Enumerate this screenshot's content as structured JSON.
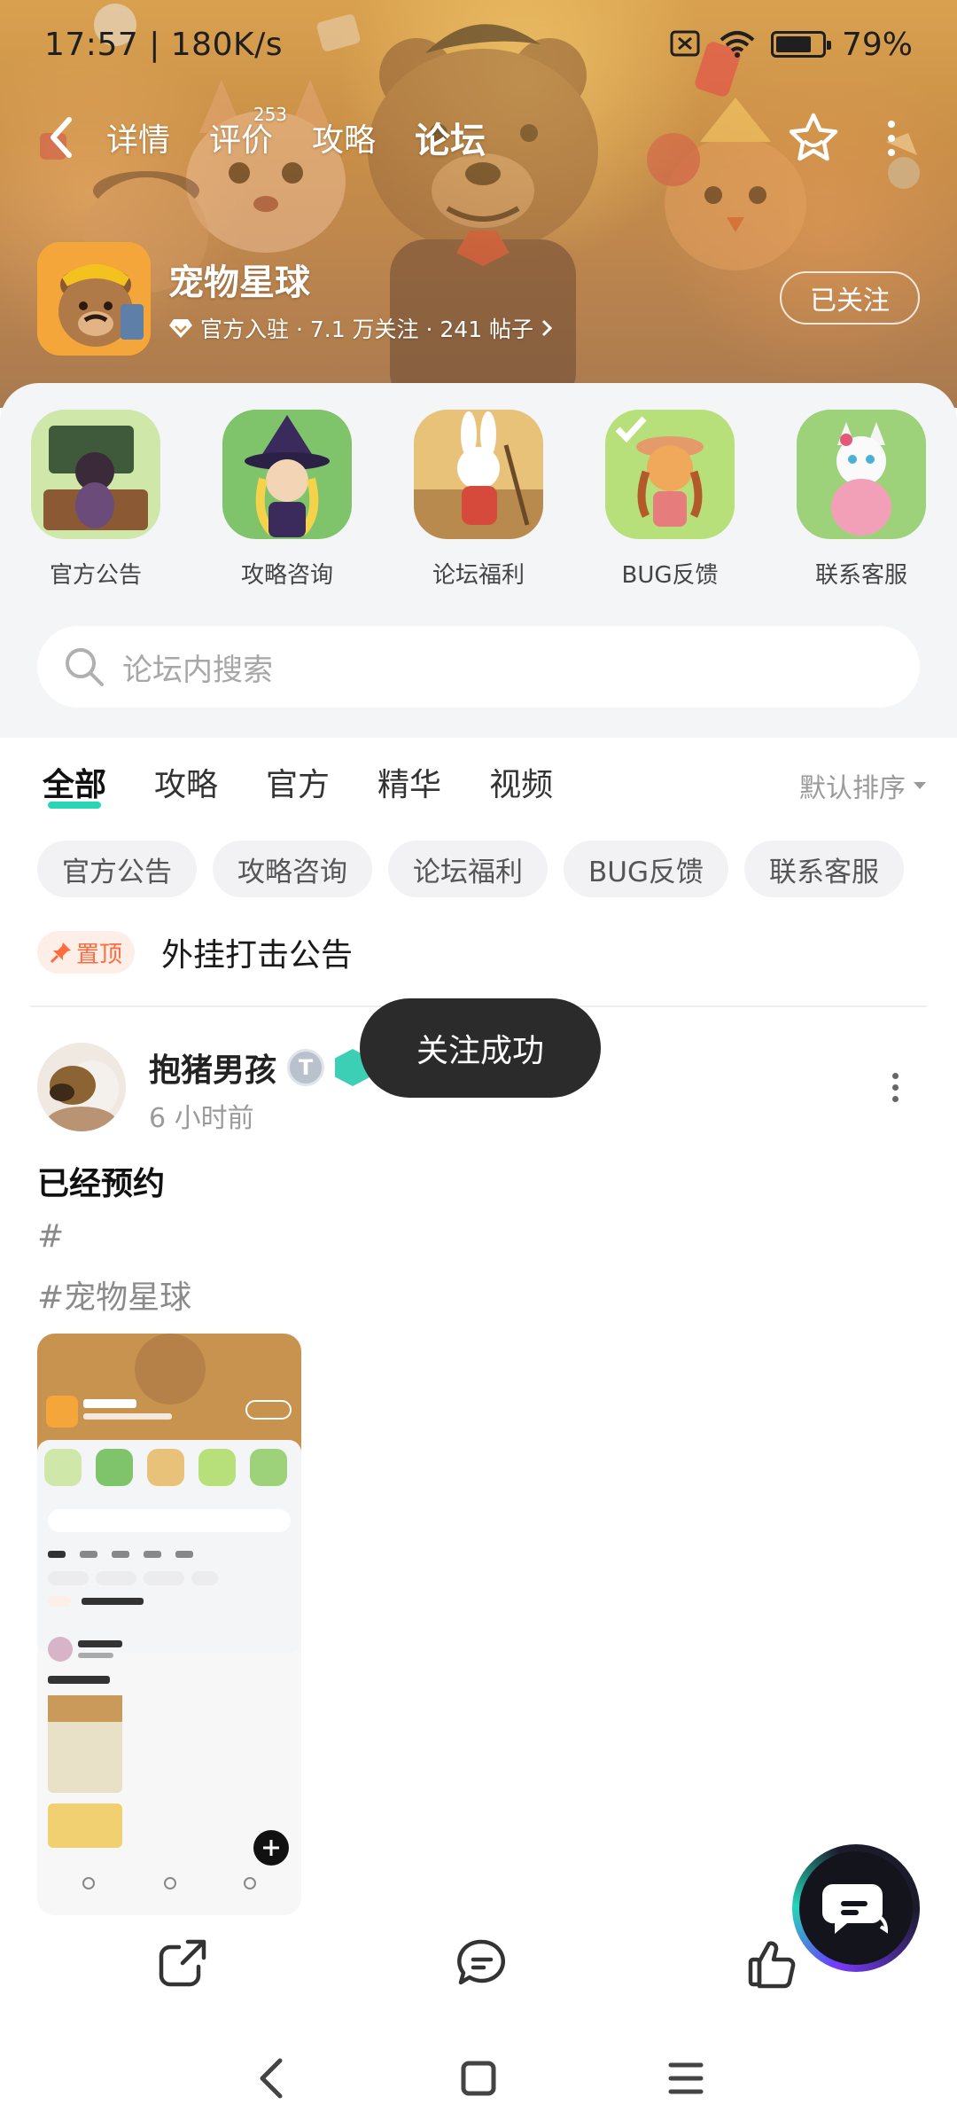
{
  "status_bar": {
    "time": "17:57",
    "net_speed": "180K/s",
    "battery": "79%",
    "battery_level": 0.79
  },
  "nav": {
    "tabs": [
      {
        "label": "详情"
      },
      {
        "label": "评价",
        "badge": "253"
      },
      {
        "label": "攻略"
      },
      {
        "label": "论坛",
        "active": true
      }
    ]
  },
  "game": {
    "name": "宠物星球",
    "meta": "官方入驻 · 7.1 万关注 · 241 帖子",
    "follow_label": "已关注"
  },
  "boards": [
    {
      "label": "官方公告"
    },
    {
      "label": "攻略咨询"
    },
    {
      "label": "论坛福利"
    },
    {
      "label": "BUG反馈"
    },
    {
      "label": "联系客服"
    }
  ],
  "search": {
    "placeholder": "论坛内搜索"
  },
  "filter_tabs": [
    {
      "label": "全部",
      "active": true
    },
    {
      "label": "攻略"
    },
    {
      "label": "官方"
    },
    {
      "label": "精华"
    },
    {
      "label": "视频"
    }
  ],
  "sort_label": "默认排序",
  "chips": [
    "官方公告",
    "攻略咨询",
    "论坛福利",
    "BUG反馈",
    "联系客服"
  ],
  "pinned": {
    "badge": "置顶",
    "title": "外挂打击公告"
  },
  "post": {
    "author": "抱猪男孩",
    "level_badge": "T",
    "time": "6 小时前",
    "title": "已经预约",
    "tag1": "#",
    "tag2": "#宠物星球"
  },
  "toast": "关注成功",
  "colors": {
    "accent": "#28d6b7",
    "pin": "#ff6b3d",
    "banner": "#c98f47"
  },
  "icons": {
    "share": "share-icon",
    "comment": "comment-icon",
    "like": "like-icon",
    "chat_fab": "chat-icon"
  }
}
